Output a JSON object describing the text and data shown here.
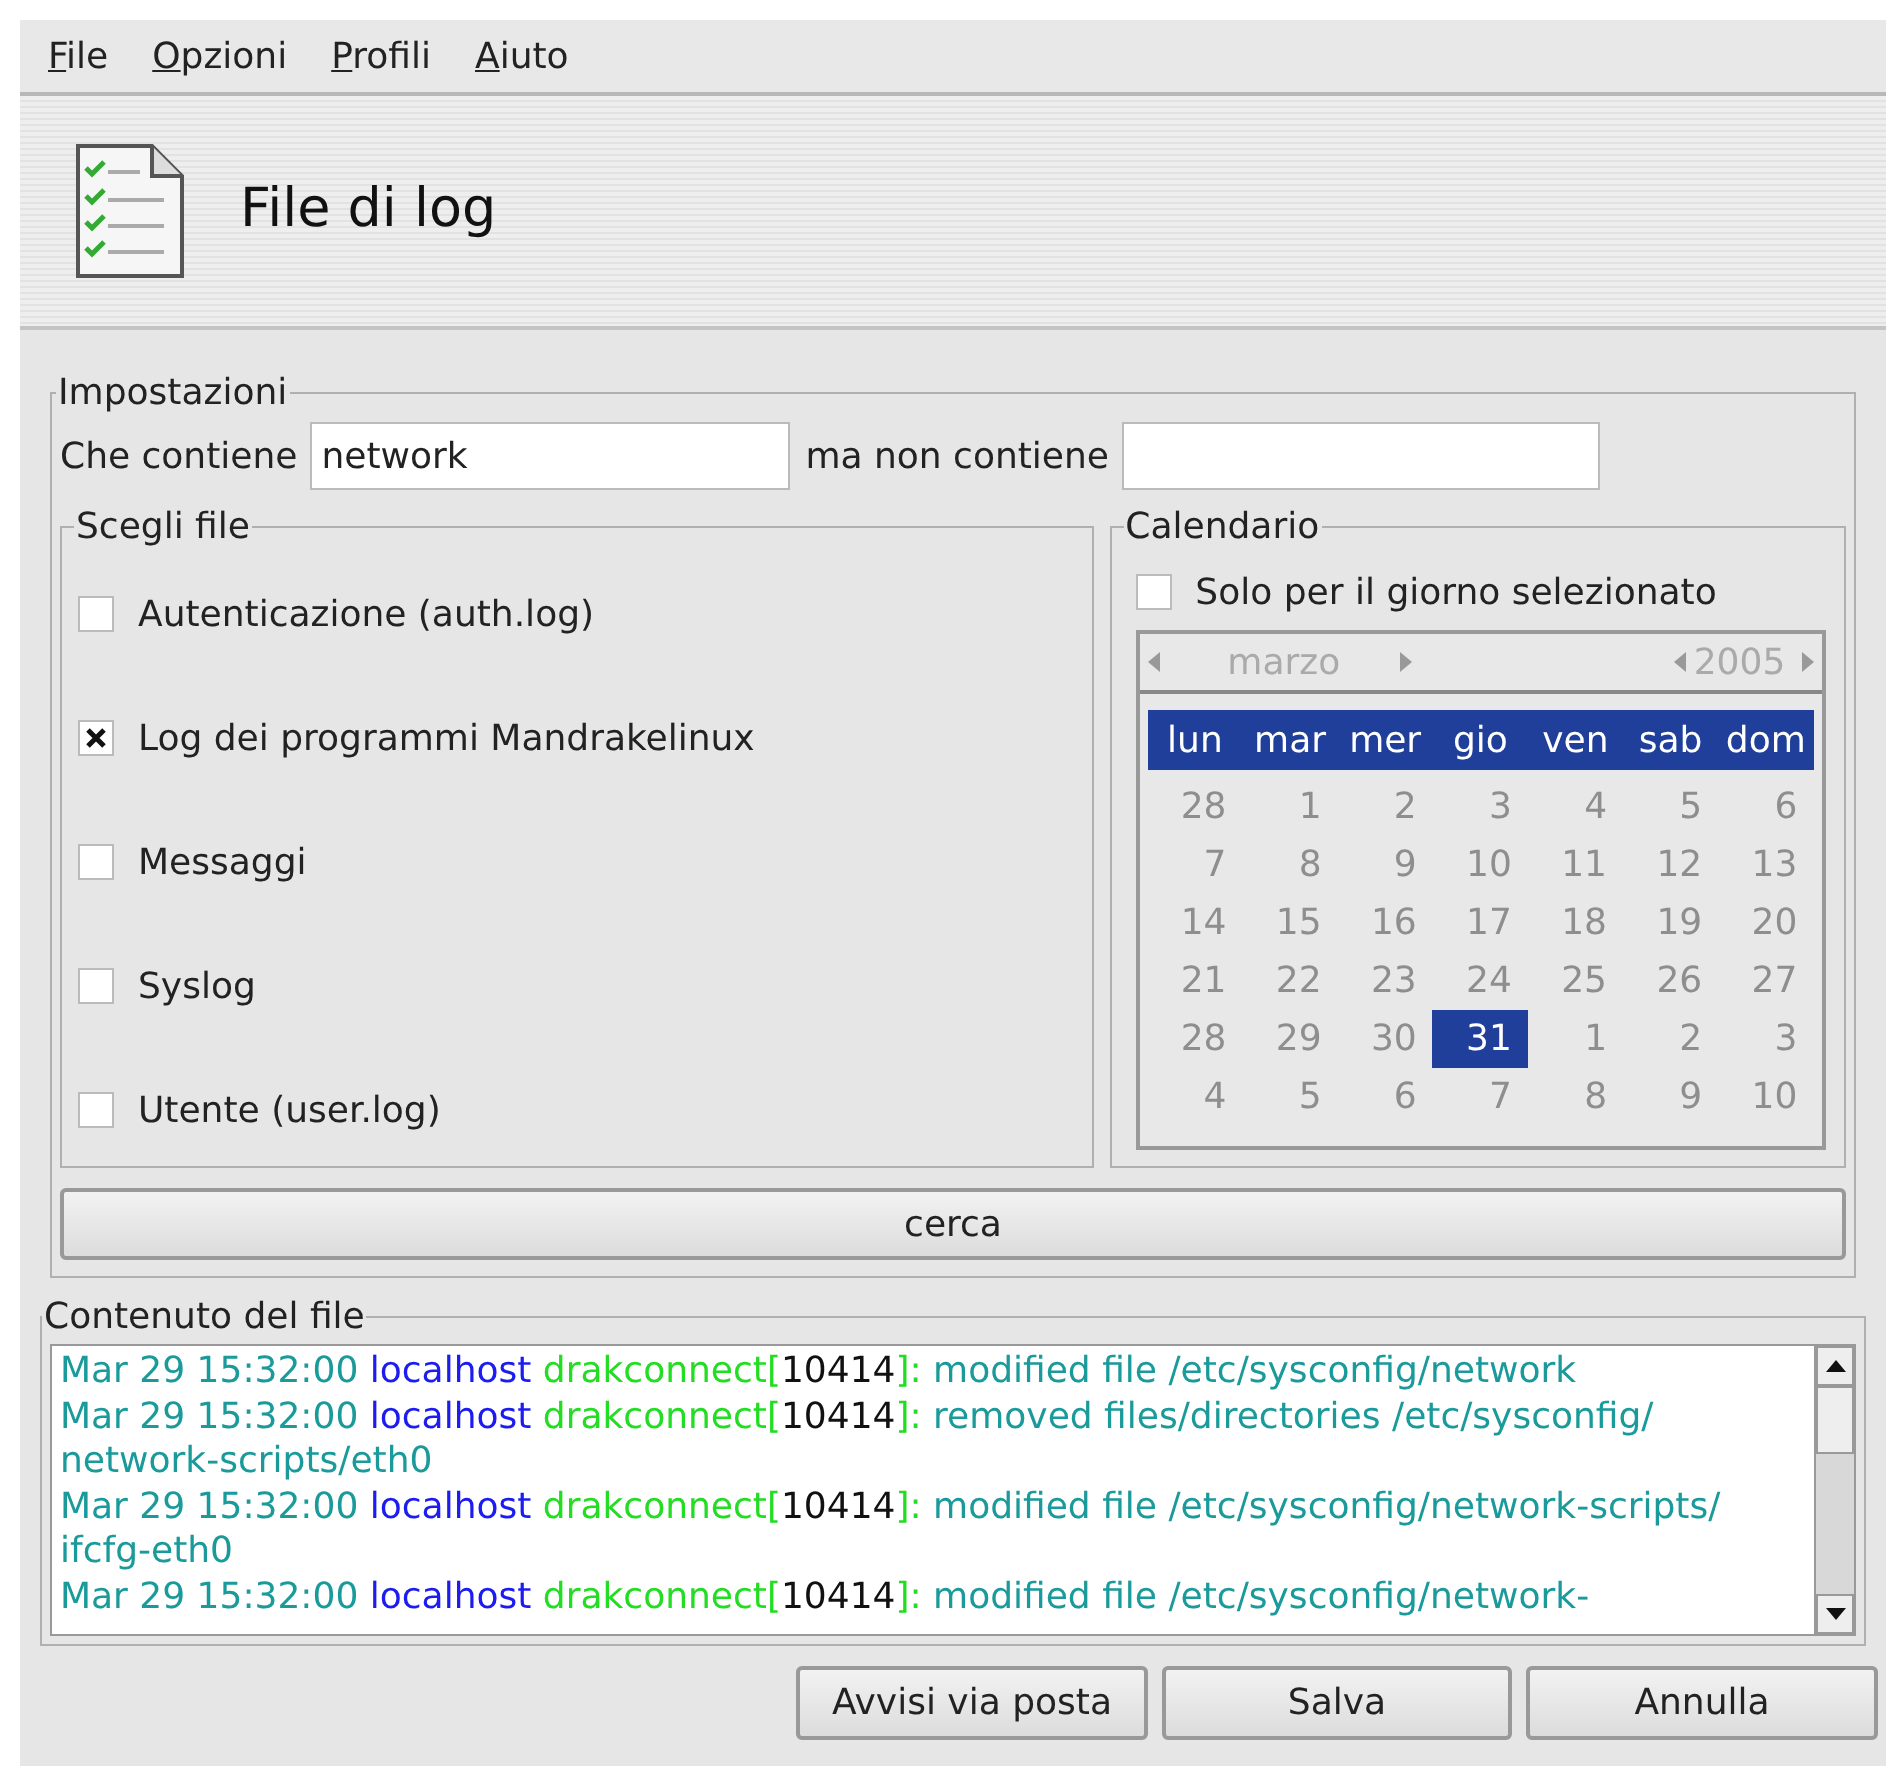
{
  "menu": [
    {
      "label": "File"
    },
    {
      "label": "Opzioni"
    },
    {
      "label": "Profili"
    },
    {
      "label": "Aiuto"
    }
  ],
  "header": {
    "title": "File di log"
  },
  "settings": {
    "legend": "Impostazioni",
    "contains_label": "Che contiene",
    "contains_value": "network",
    "excludes_label": "ma non contiene"
  },
  "files": {
    "legend": "Scegli file",
    "items": [
      {
        "label": "Autenticazione (auth.log)",
        "checked": false
      },
      {
        "label": "Log dei programmi Mandrakelinux",
        "checked": true
      },
      {
        "label": "Messaggi",
        "checked": false
      },
      {
        "label": "Syslog",
        "checked": false
      },
      {
        "label": "Utente (user.log)",
        "checked": false
      }
    ]
  },
  "calendar": {
    "legend": "Calendario",
    "only_selected_day": {
      "label": "Solo per il giorno selezionato",
      "checked": false
    },
    "disabled": true,
    "month": "marzo",
    "year": "2005",
    "weekdays": [
      "lun",
      "mar",
      "mer",
      "gio",
      "ven",
      "sab",
      "dom"
    ],
    "weeks": [
      [
        {
          "label": "28",
          "selected": false
        },
        {
          "label": "1",
          "selected": false
        },
        {
          "label": "2",
          "selected": false
        },
        {
          "label": "3",
          "selected": false
        },
        {
          "label": "4",
          "selected": false
        },
        {
          "label": "5",
          "selected": false
        },
        {
          "label": "6",
          "selected": false
        }
      ],
      [
        {
          "label": "7",
          "selected": false
        },
        {
          "label": "8",
          "selected": false
        },
        {
          "label": "9",
          "selected": false
        },
        {
          "label": "10",
          "selected": false
        },
        {
          "label": "11",
          "selected": false
        },
        {
          "label": "12",
          "selected": false
        },
        {
          "label": "13",
          "selected": false
        }
      ],
      [
        {
          "label": "14",
          "selected": false
        },
        {
          "label": "15",
          "selected": false
        },
        {
          "label": "16",
          "selected": false
        },
        {
          "label": "17",
          "selected": false
        },
        {
          "label": "18",
          "selected": false
        },
        {
          "label": "19",
          "selected": false
        },
        {
          "label": "20",
          "selected": false
        }
      ],
      [
        {
          "label": "21",
          "selected": false
        },
        {
          "label": "22",
          "selected": false
        },
        {
          "label": "23",
          "selected": false
        },
        {
          "label": "24",
          "selected": false
        },
        {
          "label": "25",
          "selected": false
        },
        {
          "label": "26",
          "selected": false
        },
        {
          "label": "27",
          "selected": false
        }
      ],
      [
        {
          "label": "28",
          "selected": false
        },
        {
          "label": "29",
          "selected": false
        },
        {
          "label": "30",
          "selected": false
        },
        {
          "label": "31",
          "selected": true
        },
        {
          "label": "1",
          "selected": false
        },
        {
          "label": "2",
          "selected": false
        },
        {
          "label": "3",
          "selected": false
        }
      ],
      [
        {
          "label": "4",
          "selected": false
        },
        {
          "label": "5",
          "selected": false
        },
        {
          "label": "6",
          "selected": false
        },
        {
          "label": "7",
          "selected": false
        },
        {
          "label": "8",
          "selected": false
        },
        {
          "label": "9",
          "selected": false
        },
        {
          "label": "10",
          "selected": false
        }
      ]
    ]
  },
  "search_button": "cerca",
  "content": {
    "legend": "Contenuto del file",
    "entries": [
      {
        "date": "Mar 29 15:32:00",
        "host": "localhost",
        "process": "drakconnect[",
        "pid": "10414",
        "pid_close": "]:",
        "message": "modified file /etc/sysconfig/network"
      },
      {
        "date": "Mar 29 15:32:00",
        "host": "localhost",
        "process": "drakconnect[",
        "pid": "10414",
        "pid_close": "]:",
        "message": "removed files/directories /etc/sysconfig/network-scripts/eth0"
      },
      {
        "date": "Mar 29 15:32:00",
        "host": "localhost",
        "process": "drakconnect[",
        "pid": "10414",
        "pid_close": "]:",
        "message": "modified file /etc/sysconfig/network-scripts/ifcfg-eth0"
      },
      {
        "date": "Mar 29 15:32:00",
        "host": "localhost",
        "process": "drakconnect[",
        "pid": "10414",
        "pid_close": "]:",
        "message": "modified file /etc/sysconfig/network-"
      }
    ]
  },
  "buttons": [
    {
      "label": "Avvisi via posta"
    },
    {
      "label": "Salva"
    },
    {
      "label": "Annulla"
    }
  ]
}
